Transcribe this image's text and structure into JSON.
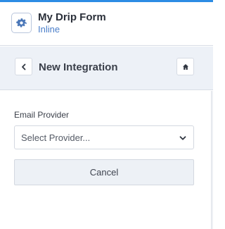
{
  "header": {
    "form_title": "My Drip Form",
    "form_type": "Inline",
    "icon": "gear-icon"
  },
  "subheader": {
    "title": "New Integration",
    "back_icon": "chevron-left-icon",
    "home_icon": "home-icon"
  },
  "form": {
    "email_provider_label": "Email Provider",
    "provider_select": {
      "placeholder": "Select Provider...",
      "icon": "chevron-down-icon"
    },
    "cancel_label": "Cancel"
  },
  "colors": {
    "accent": "#2d8ce4",
    "subheader_bg": "#edf1f7",
    "form_type_text": "#4a7ec9"
  }
}
